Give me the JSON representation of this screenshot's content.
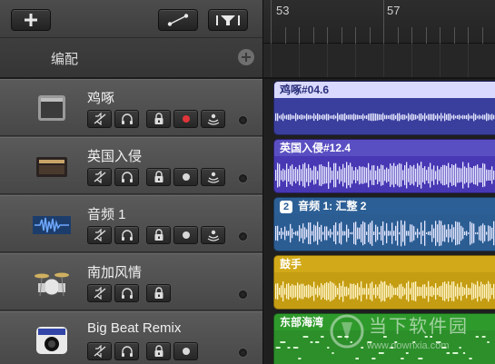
{
  "toolbar": {
    "add_icon": "plus-icon",
    "automation_icon": "automation-curve-icon",
    "filter_icon": "smart-controls-filter-icon"
  },
  "arrange": {
    "label": "编配",
    "add_icon": "plus-circle-icon"
  },
  "ruler": {
    "bars": [
      "53",
      "57"
    ]
  },
  "tracks": [
    {
      "name": "鸡啄",
      "icon": "guitar-amp-icon",
      "record_armed": true,
      "record_color": "#e0353a",
      "region": {
        "label": "鸡啄#04.6",
        "badge": "",
        "head_color": "#d9d9ff",
        "body_color": "#3a3f9e",
        "text_color": "#2a2f7a"
      }
    },
    {
      "name": "英国入侵",
      "icon": "british-amp-icon",
      "record_armed": false,
      "region": {
        "label": "英国入侵#12.4",
        "badge": "",
        "head_color": "#5a4fc2",
        "body_color": "#4838b4",
        "text_color": "#ffffff"
      }
    },
    {
      "name": "音频 1",
      "icon": "audio-waveform-icon",
      "record_armed": false,
      "region": {
        "label": "音频 1: 汇整 2",
        "badge": "2",
        "head_color": "#2c5f95",
        "body_color": "#2b5d93",
        "text_color": "#ffffff"
      }
    },
    {
      "name": "南加风情",
      "icon": "drum-kit-icon",
      "record_armed": false,
      "region": {
        "label": "鼓手",
        "badge": "",
        "head_color": "#d2a918",
        "body_color": "#c59d13",
        "text_color": "#ffffff"
      }
    },
    {
      "name": "Big Beat Remix",
      "icon": "drum-machine-icon",
      "record_armed": false,
      "region": {
        "label": "东部海湾",
        "badge": "",
        "head_color": "#2f9a2c",
        "body_color": "#2c8f2a",
        "text_color": "#ffffff"
      }
    }
  ],
  "watermark": {
    "name": "当下软件园",
    "url": "www.downxia.com",
    "icon": "downxia-logo-icon"
  }
}
